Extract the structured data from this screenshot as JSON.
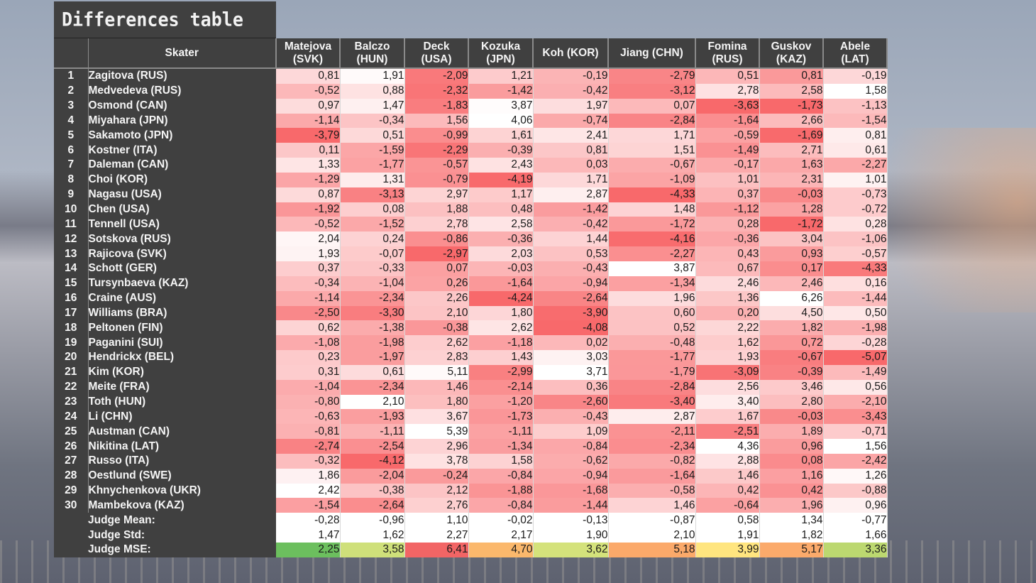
{
  "title": "Differences table",
  "header": {
    "skater": "Skater",
    "judges": [
      [
        "Matejova",
        "(SVK)"
      ],
      [
        "Balczo",
        "(HUN)"
      ],
      [
        "Deck",
        "(USA)"
      ],
      [
        "Kozuka",
        "(JPN)"
      ],
      [
        "Koh (KOR)"
      ],
      [
        "Jiang (CHN)"
      ],
      [
        "Fomina",
        "(RUS)"
      ],
      [
        "Guskov",
        "(KAZ)"
      ],
      [
        "Abele",
        "(LAT)"
      ]
    ]
  },
  "colors": {
    "panel": "#404040",
    "white": "#ffffff",
    "red": "#f8696b",
    "yellow": "#ffeb84",
    "green": "#63be7b"
  },
  "rows": [
    {
      "rank": "1",
      "name": "Zagitova (RUS)",
      "values": [
        "0,81",
        "1,91",
        "-2,09",
        "1,21",
        "-0,19",
        "-2,79",
        "0,51",
        "0,81",
        "-0,19"
      ]
    },
    {
      "rank": "2",
      "name": "Medvedeva (RUS)",
      "values": [
        "-0,52",
        "0,88",
        "-2,32",
        "-1,42",
        "-0,42",
        "-3,12",
        "2,78",
        "2,58",
        "1,58"
      ]
    },
    {
      "rank": "3",
      "name": "Osmond (CAN)",
      "values": [
        "0,97",
        "1,47",
        "-1,83",
        "3,87",
        "1,97",
        "0,07",
        "-3,63",
        "-1,73",
        "-1,13"
      ]
    },
    {
      "rank": "4",
      "name": "Miyahara (JPN)",
      "values": [
        "-1,14",
        "-0,34",
        "1,56",
        "4,06",
        "-0,74",
        "-2,84",
        "-1,64",
        "2,66",
        "-1,54"
      ]
    },
    {
      "rank": "5",
      "name": "Sakamoto (JPN)",
      "values": [
        "-3,79",
        "0,51",
        "-0,99",
        "1,61",
        "2,41",
        "1,71",
        "-0,59",
        "-1,69",
        "0,81"
      ]
    },
    {
      "rank": "6",
      "name": "Kostner (ITA)",
      "values": [
        "0,11",
        "-1,59",
        "-2,29",
        "-0,39",
        "0,81",
        "1,51",
        "-1,49",
        "2,71",
        "0,61"
      ]
    },
    {
      "rank": "7",
      "name": "Daleman (CAN)",
      "values": [
        "1,33",
        "-1,77",
        "-0,57",
        "2,43",
        "0,03",
        "-0,67",
        "-0,17",
        "1,63",
        "-2,27"
      ]
    },
    {
      "rank": "8",
      "name": "Choi (KOR)",
      "values": [
        "-1,29",
        "1,31",
        "-0,79",
        "-4,19",
        "1,71",
        "-1,09",
        "1,01",
        "2,31",
        "1,01"
      ]
    },
    {
      "rank": "9",
      "name": "Nagasu (USA)",
      "values": [
        "0,87",
        "-3,13",
        "2,97",
        "1,17",
        "2,87",
        "-4,33",
        "0,37",
        "-0,03",
        "-0,73"
      ]
    },
    {
      "rank": "10",
      "name": "Chen (USA)",
      "values": [
        "-1,92",
        "0,08",
        "1,88",
        "0,48",
        "-1,42",
        "1,48",
        "-1,12",
        "1,28",
        "-0,72"
      ]
    },
    {
      "rank": "11",
      "name": "Tennell (USA)",
      "values": [
        "-0,52",
        "-1,52",
        "2,78",
        "2,58",
        "-0,42",
        "-1,72",
        "0,28",
        "-1,72",
        "0,28"
      ]
    },
    {
      "rank": "12",
      "name": "Sotskova (RUS)",
      "values": [
        "2,04",
        "0,24",
        "-0,86",
        "-0,36",
        "1,44",
        "-4,16",
        "-0,36",
        "3,04",
        "-1,06"
      ]
    },
    {
      "rank": "13",
      "name": "Rajicova (SVK)",
      "values": [
        "1,93",
        "-0,07",
        "-2,97",
        "2,03",
        "0,53",
        "-2,27",
        "0,43",
        "0,93",
        "-0,57"
      ]
    },
    {
      "rank": "14",
      "name": "Schott (GER)",
      "values": [
        "0,37",
        "-0,33",
        "0,07",
        "-0,03",
        "-0,43",
        "3,87",
        "0,67",
        "0,17",
        "-4,33"
      ]
    },
    {
      "rank": "15",
      "name": "Tursynbaeva (KAZ)",
      "values": [
        "-0,34",
        "-1,04",
        "0,26",
        "-1,64",
        "-0,94",
        "-1,34",
        "2,46",
        "2,46",
        "0,16"
      ]
    },
    {
      "rank": "16",
      "name": "Craine (AUS)",
      "values": [
        "-1,14",
        "-2,34",
        "2,26",
        "-4,24",
        "-2,64",
        "1,96",
        "1,36",
        "6,26",
        "-1,44"
      ]
    },
    {
      "rank": "17",
      "name": "Williams  (BRA)",
      "values": [
        "-2,50",
        "-3,30",
        "2,10",
        "1,80",
        "-3,90",
        "0,60",
        "0,20",
        "4,50",
        "0,50"
      ]
    },
    {
      "rank": "18",
      "name": "Peltonen (FIN)",
      "values": [
        "0,62",
        "-1,38",
        "-0,38",
        "2,62",
        "-4,08",
        "0,52",
        "2,22",
        "1,82",
        "-1,98"
      ]
    },
    {
      "rank": "19",
      "name": "Paganini (SUI)",
      "values": [
        "-1,08",
        "-1,98",
        "2,62",
        "-1,18",
        "0,02",
        "-0,48",
        "1,62",
        "0,72",
        "-0,28"
      ]
    },
    {
      "rank": "20",
      "name": "Hendrickx (BEL)",
      "values": [
        "0,23",
        "-1,97",
        "2,83",
        "1,43",
        "3,03",
        "-1,77",
        "1,93",
        "-0,67",
        "-5,07"
      ]
    },
    {
      "rank": "21",
      "name": "Kim (KOR)",
      "values": [
        "0,31",
        "0,61",
        "5,11",
        "-2,99",
        "3,71",
        "-1,79",
        "-3,09",
        "-0,39",
        "-1,49"
      ]
    },
    {
      "rank": "22",
      "name": "Meite (FRA)",
      "values": [
        "-1,04",
        "-2,34",
        "1,46",
        "-2,14",
        "0,36",
        "-2,84",
        "2,56",
        "3,46",
        "0,56"
      ]
    },
    {
      "rank": "23",
      "name": "Toth (HUN)",
      "values": [
        "-0,80",
        "2,10",
        "1,80",
        "-1,20",
        "-2,60",
        "-3,40",
        "3,40",
        "2,80",
        "-2,10"
      ]
    },
    {
      "rank": "24",
      "name": "Li (CHN)",
      "values": [
        "-0,63",
        "-1,93",
        "3,67",
        "-1,73",
        "-0,43",
        "2,87",
        "1,67",
        "-0,03",
        "-3,43"
      ]
    },
    {
      "rank": "25",
      "name": "Austman  (CAN)",
      "values": [
        "-0,81",
        "-1,11",
        "5,39",
        "-1,11",
        "1,09",
        "-2,11",
        "-2,51",
        "1,89",
        "-0,71"
      ]
    },
    {
      "rank": "26",
      "name": "Nikitina (LAT)",
      "values": [
        "-2,74",
        "-2,54",
        "2,96",
        "-1,34",
        "-0,84",
        "-2,34",
        "4,36",
        "0,96",
        "1,56"
      ]
    },
    {
      "rank": "27",
      "name": "Russo (ITA)",
      "values": [
        "-0,32",
        "-4,12",
        "3,78",
        "1,58",
        "-0,62",
        "-0,82",
        "2,88",
        "0,08",
        "-2,42"
      ]
    },
    {
      "rank": "28",
      "name": "Oestlund (SWE)",
      "values": [
        "1,86",
        "-2,04",
        "-0,24",
        "-0,84",
        "-0,94",
        "-1,64",
        "1,46",
        "1,16",
        "1,26"
      ]
    },
    {
      "rank": "29",
      "name": "Khnychenkova (UKR)",
      "values": [
        "2,42",
        "-0,38",
        "2,12",
        "-1,88",
        "-1,68",
        "-0,58",
        "0,42",
        "0,42",
        "-0,88"
      ]
    },
    {
      "rank": "30",
      "name": "Mambekova (KAZ)",
      "values": [
        "-1,54",
        "-2,64",
        "2,76",
        "-0,84",
        "-1,44",
        "1,46",
        "-0,64",
        "1,96",
        "0,96"
      ]
    }
  ],
  "footer": [
    {
      "label": "Judge Mean:",
      "values": [
        "-0,28",
        "-0,96",
        "1,10",
        "-0,02",
        "-0,13",
        "-0,87",
        "0,58",
        "1,34",
        "-0,77"
      ]
    },
    {
      "label": "Judge Std:",
      "values": [
        "1,47",
        "1,62",
        "2,27",
        "2,17",
        "1,90",
        "2,10",
        "1,91",
        "1,82",
        "1,66"
      ]
    },
    {
      "label": "Judge MSE:",
      "values": [
        "2,25",
        "3,58",
        "6,41",
        "4,70",
        "3,62",
        "5,18",
        "3,99",
        "5,17",
        "3,36"
      ],
      "colors": [
        "#6cbf5e",
        "#cfe07a",
        "#f26565",
        "#fbb86c",
        "#d4e27b",
        "#fba96a",
        "#ffe57f",
        "#fbaa6b",
        "#bcd870"
      ]
    }
  ]
}
